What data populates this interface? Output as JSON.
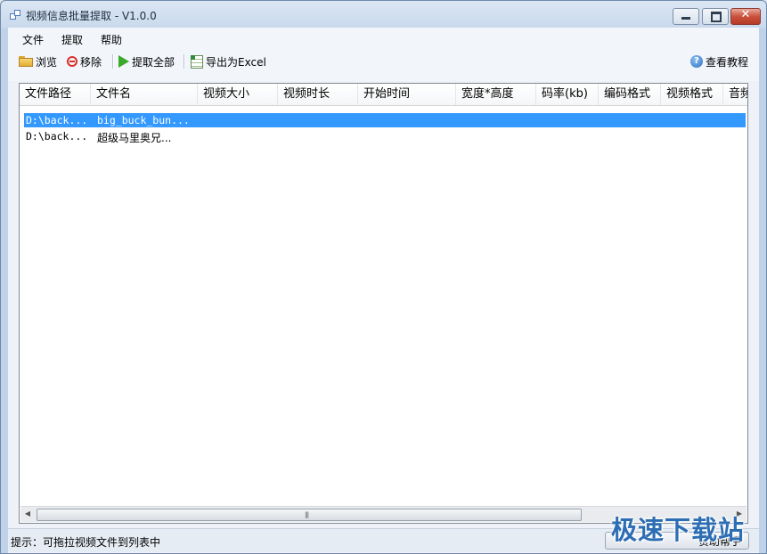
{
  "window": {
    "title": "视频信息批量提取 - V1.0.0"
  },
  "menu": {
    "items": [
      "文件",
      "提取",
      "帮助"
    ]
  },
  "toolbar": {
    "browse": "浏览",
    "remove": "移除",
    "extract_all": "提取全部",
    "export_excel": "导出为Excel",
    "tutorial": "查看教程"
  },
  "table": {
    "columns": [
      "文件路径",
      "文件名",
      "视频大小",
      "视频时长",
      "开始时间",
      "宽度*高度",
      "码率(kb)",
      "编码格式",
      "视频格式",
      "音频"
    ],
    "rows": [
      {
        "path": "D:\\back...",
        "name": "big_buck_bun...",
        "selected": true
      },
      {
        "path": "D:\\back...",
        "name": "超级马里奥兄...",
        "selected": false
      }
    ]
  },
  "scrollbar": {
    "grip": "|||"
  },
  "status": {
    "hint": "提示：可拖拉视频文件到列表中",
    "about_button": "赞助帮手"
  },
  "watermark": "极速下载站",
  "colors": {
    "selection": "#3399ff",
    "close_button": "#c9513d",
    "watermark": "#2d6db3"
  }
}
